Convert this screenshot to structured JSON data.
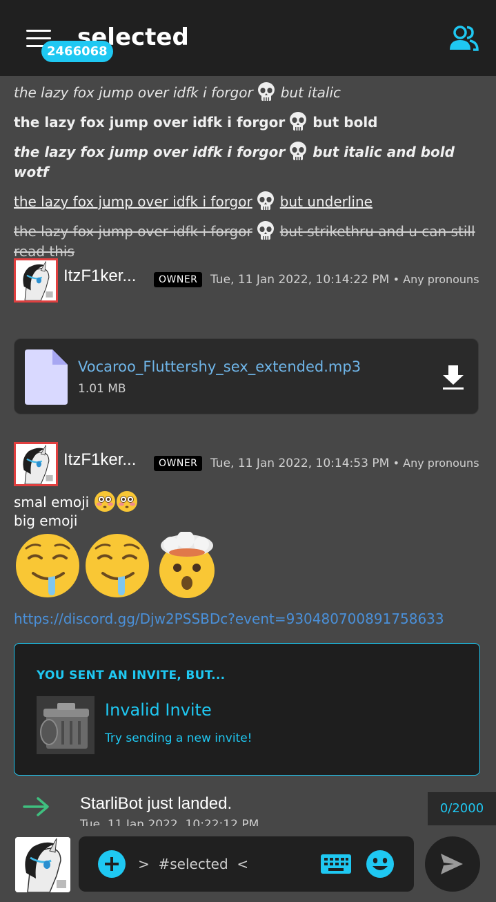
{
  "header": {
    "channel_title": "selected",
    "notification_count": "2466068"
  },
  "format_lines": [
    {
      "before": "the lazy fox jump over idfk i forgor",
      "after": "but italic"
    },
    {
      "before": "the lazy fox jump over idfk i forgor",
      "after": "but bold"
    },
    {
      "before": "the lazy fox jump over idfk i forgor",
      "after": "but italic and bold wotf"
    },
    {
      "before": "the lazy fox jump over idfk i forgor",
      "after": "but underline"
    },
    {
      "before": "the lazy fox jump over idfk i forgor",
      "after": "but strikethru and u can still read this"
    }
  ],
  "messages": [
    {
      "author": "ItzF1ker...",
      "tag": "OWNER",
      "timestamp": "Tue, 11 Jan 2022, 10:14:22 PM",
      "pronouns": "• Any pronouns",
      "attachment": {
        "name": "Vocaroo_Fluttershy_sex_extended.mp3",
        "size": "1.01 MB"
      }
    },
    {
      "author": "ItzF1ker...",
      "tag": "OWNER",
      "timestamp": "Tue, 11 Jan 2022, 10:14:53 PM",
      "pronouns": "• Any pronouns",
      "line1": "smal emoji",
      "line2": "big emoji",
      "link": "https://discord.gg/Djw2PSSBDc?event=930480700891758633",
      "invite": {
        "heading": "YOU SENT AN INVITE, BUT...",
        "title": "Invalid Invite",
        "subtitle": "Try sending a new invite!"
      }
    }
  ],
  "system_message": {
    "text": "StarliBot just landed.",
    "timestamp": "Tue, 11 Jan 2022, 10:22:12 PM"
  },
  "composer": {
    "placeholder": ">  #selected  <",
    "char_count": "0/2000"
  },
  "colors": {
    "accent": "#1fc8f2",
    "background": "#474747",
    "header": "#202020",
    "link": "#4a90d9",
    "owner_tag": "#000000",
    "join_arrow": "#3fbf7f"
  },
  "icons": {
    "menu": "hamburger-icon",
    "members": "users-icon",
    "file": "file-icon",
    "download": "download-icon",
    "join": "arrow-right-icon",
    "add": "plus-circle-icon",
    "keyboard": "keyboard-icon",
    "emoji": "smile-icon",
    "send": "send-icon"
  }
}
